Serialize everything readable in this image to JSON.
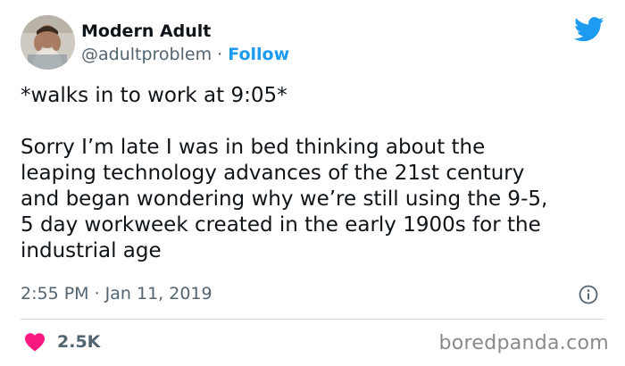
{
  "tweet": {
    "author_name": "Modern Adult",
    "handle": "@adultproblem",
    "separator": "·",
    "follow_label": "Follow",
    "text": "*walks in to work at 9:05*\n\nSorry I’m late I was in bed thinking about the\nleaping technology advances of the 21st century\nand began wondering why we’re still using the 9-5,\n5 day workweek created in the early 1900s for the\nindustrial age",
    "time": "2:55 PM · Jan 11, 2019",
    "likes": "2.5K"
  },
  "watermark": "boredpanda.com",
  "icons": {
    "platform": "twitter-bird-icon",
    "info": "info-icon",
    "like": "heart-icon"
  },
  "colors": {
    "accent": "#1d9bf0",
    "like": "#f91880",
    "muted": "#536471",
    "divider": "#cfd9de"
  }
}
